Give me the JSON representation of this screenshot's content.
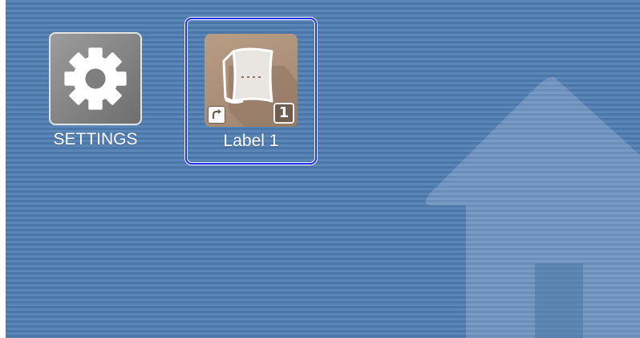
{
  "desktop": {
    "apps": [
      {
        "id": "settings",
        "label": "SETTINGS",
        "icon": "gear-icon"
      },
      {
        "id": "label-1",
        "label": "Label 1",
        "icon": "label-tape-icon",
        "badge": "1",
        "selected": true
      }
    ],
    "background_icon": "home-icon"
  },
  "colors": {
    "background": "#4f7cae",
    "selection_border": "#1f2cf0",
    "label_tile": "#b09580",
    "settings_tile": "#858585"
  }
}
